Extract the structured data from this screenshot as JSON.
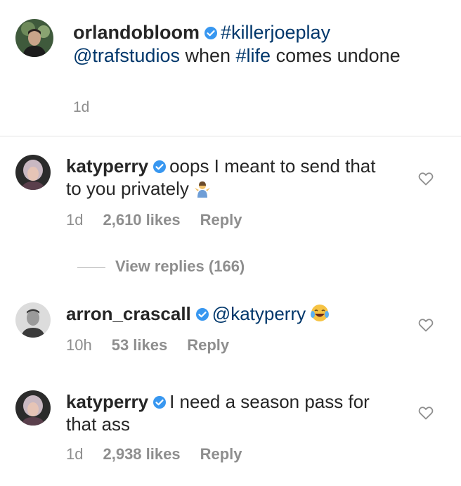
{
  "caption": {
    "username": "orlandobloom",
    "hashtag1": "#killerjoeplay",
    "mention": "@trafstudios",
    "text_mid": " when ",
    "hashtag2": "#life",
    "text_end": " comes undone",
    "time": "1d"
  },
  "comments": [
    {
      "username": "katyperry",
      "text": "oops I meant to send that to you privately",
      "emoji": "person-shrugging-emoji",
      "time": "1d",
      "likes": "2,610 likes",
      "reply": "Reply"
    },
    {
      "username": "arron_crascall",
      "mention": "@katyperry",
      "emoji": "tears-of-joy-emoji",
      "time": "10h",
      "likes": "53 likes",
      "reply": "Reply"
    },
    {
      "username": "katyperry",
      "text": "I need a season pass for that ass",
      "time": "1d",
      "likes": "2,938 likes",
      "reply": "Reply"
    }
  ],
  "view_replies": "View replies (166)",
  "colors": {
    "text": "#262626",
    "muted": "#8e8e8e",
    "link": "#00376b",
    "verified": "#3897f0"
  }
}
